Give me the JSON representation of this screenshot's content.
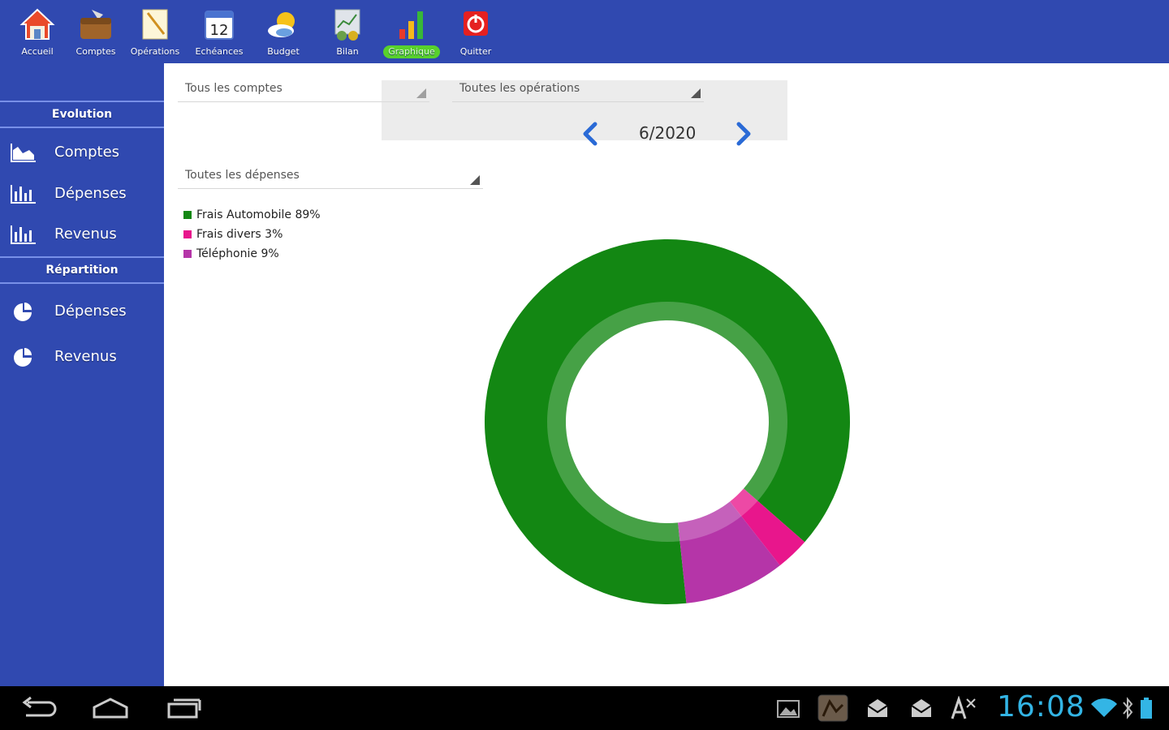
{
  "toolbar": {
    "items": [
      {
        "label": "Accueil",
        "icon": "home-icon"
      },
      {
        "label": "Comptes",
        "icon": "wallet-icon"
      },
      {
        "label": "Opérations",
        "icon": "notepad-icon"
      },
      {
        "label": "Echéances",
        "icon": "calendar-icon"
      },
      {
        "label": "Budget",
        "icon": "weather-icon"
      },
      {
        "label": "Bilan",
        "icon": "chart-report-icon"
      },
      {
        "label": "Graphique",
        "icon": "bar-chart-icon"
      },
      {
        "label": "Quitter",
        "icon": "power-icon"
      }
    ],
    "calendar_day": "12",
    "active": "Graphique"
  },
  "sidebar": {
    "sections": [
      {
        "title": "Evolution",
        "items": [
          {
            "label": "Comptes",
            "icon": "area-chart-icon"
          },
          {
            "label": "Dépenses",
            "icon": "bar-chart-icon"
          },
          {
            "label": "Revenus",
            "icon": "bar-chart-icon"
          }
        ]
      },
      {
        "title": "Répartition",
        "items": [
          {
            "label": "Dépenses",
            "icon": "pie-chart-icon"
          },
          {
            "label": "Revenus",
            "icon": "pie-chart-icon"
          }
        ]
      }
    ]
  },
  "filters": {
    "accounts": "Tous les comptes",
    "operations": "Toutes les opérations",
    "category": "Toutes les dépenses"
  },
  "period": {
    "label": "6/2020"
  },
  "chart_data": {
    "type": "pie",
    "donut": true,
    "slices": [
      {
        "label": "Frais Automobile 89%",
        "value": 89,
        "color": "#138713"
      },
      {
        "label": "Frais divers 3%",
        "value": 3,
        "color": "#e8168c"
      },
      {
        "label": "Téléphonie 9%",
        "value": 9,
        "color": "#b535a8"
      }
    ],
    "legend": "top-left"
  },
  "system": {
    "clock": "16:08",
    "accent": "#33b5e5"
  }
}
